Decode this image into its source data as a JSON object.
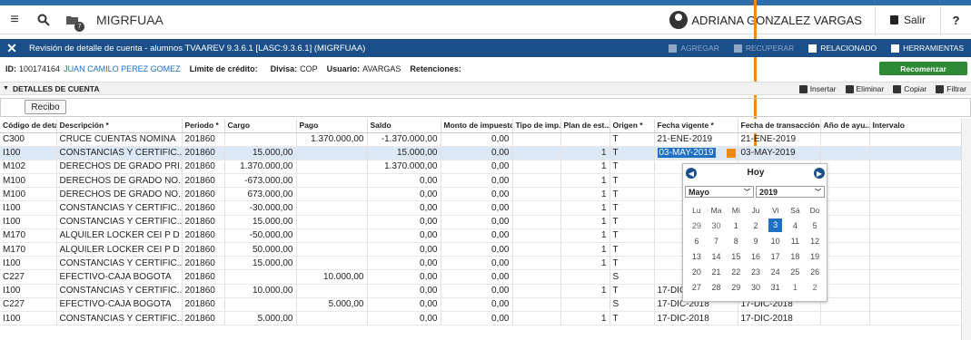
{
  "app": {
    "name": "MIGRFUAA",
    "badge": "7",
    "user": "ADRIANA GONZALEZ VARGAS",
    "logout": "Salir",
    "help": "?"
  },
  "form": {
    "title": "Revisión de detalle de cuenta - alumnos TVAAREV 9.3.6.1 [LASC:9.3.6.1] (MIGRFUAA)",
    "actions": [
      "AGREGAR",
      "RECUPERAR",
      "RELACIONADO",
      "HERRAMIENTAS"
    ]
  },
  "key": {
    "id_label": "ID:",
    "id_value": "100174164",
    "name": "JUAN CAMILO PEREZ GOMEZ",
    "credit_label": "Límite de crédito:",
    "currency_label": "Divisa:",
    "currency_value": "COP",
    "user_label": "Usuario:",
    "user_value": "AVARGAS",
    "retentions_label": "Retenciones:",
    "start_over": "Recomenzar"
  },
  "section": {
    "title": "DETALLES DE CUENTA",
    "tools": [
      "Insertar",
      "Eliminar",
      "Copiar",
      "Filtrar"
    ],
    "recibo": "Recibo"
  },
  "grid": {
    "columns": [
      "Código de deta...",
      "Descripción *",
      "Periodo *",
      "Cargo",
      "Pago",
      "Saldo",
      "Monto de impuesto",
      "Tipo de imp...",
      "Plan de est...",
      "Origen *",
      "Fecha vigente *",
      "Fecha de transacción",
      "Año de ayu...",
      "Intervalo"
    ],
    "rows": [
      [
        "C300",
        "CRUCE CUENTAS NOMINA",
        "201860",
        "",
        "1.370.000,00",
        "-1.370.000,00",
        "0,00",
        "",
        "",
        "T",
        "21-ENE-2019",
        "21-ENE-2019",
        "",
        ""
      ],
      [
        "I100",
        "CONSTANCIAS Y CERTIFIC...",
        "201860",
        "15.000,00",
        "",
        "15.000,00",
        "0,00",
        "",
        "1",
        "T",
        "03-MAY-2019",
        "03-MAY-2019",
        "",
        ""
      ],
      [
        "M102",
        "DERECHOS DE GRADO PRI...",
        "201860",
        "1.370.000,00",
        "",
        "1.370.000,00",
        "0,00",
        "",
        "1",
        "T",
        "",
        "",
        "",
        ""
      ],
      [
        "M100",
        "DERECHOS DE GRADO NO...",
        "201860",
        "-673.000,00",
        "",
        "0,00",
        "0,00",
        "",
        "1",
        "T",
        "",
        "",
        "",
        ""
      ],
      [
        "M100",
        "DERECHOS DE GRADO NO...",
        "201860",
        "673.000,00",
        "",
        "0,00",
        "0,00",
        "",
        "1",
        "T",
        "",
        "",
        "",
        ""
      ],
      [
        "I100",
        "CONSTANCIAS Y CERTIFIC...",
        "201860",
        "-30.000,00",
        "",
        "0,00",
        "0,00",
        "",
        "1",
        "T",
        "",
        "",
        "",
        ""
      ],
      [
        "I100",
        "CONSTANCIAS Y CERTIFIC...",
        "201860",
        "15.000,00",
        "",
        "0,00",
        "0,00",
        "",
        "1",
        "T",
        "",
        "",
        "",
        ""
      ],
      [
        "M170",
        "ALQUILER LOCKER CEI P D",
        "201860",
        "-50.000,00",
        "",
        "0,00",
        "0,00",
        "",
        "1",
        "T",
        "",
        "",
        "",
        ""
      ],
      [
        "M170",
        "ALQUILER LOCKER CEI P D",
        "201860",
        "50.000,00",
        "",
        "0,00",
        "0,00",
        "",
        "1",
        "T",
        "",
        "",
        "",
        ""
      ],
      [
        "I100",
        "CONSTANCIAS Y CERTIFIC...",
        "201860",
        "15.000,00",
        "",
        "0,00",
        "0,00",
        "",
        "1",
        "T",
        "",
        "",
        "",
        ""
      ],
      [
        "C227",
        "EFECTIVO-CAJA BOGOTA",
        "201860",
        "",
        "10.000,00",
        "0,00",
        "0,00",
        "",
        "",
        "S",
        "",
        "",
        "",
        ""
      ],
      [
        "I100",
        "CONSTANCIAS Y CERTIFIC...",
        "201860",
        "10.000,00",
        "",
        "0,00",
        "0,00",
        "",
        "1",
        "T",
        "17-DIC-2018",
        "17-DIC-2018",
        "",
        ""
      ],
      [
        "C227",
        "EFECTIVO-CAJA BOGOTA",
        "201860",
        "",
        "5.000,00",
        "0,00",
        "0,00",
        "",
        "",
        "S",
        "17-DIC-2018",
        "17-DIC-2018",
        "",
        ""
      ],
      [
        "I100",
        "CONSTANCIAS Y CERTIFIC...",
        "201860",
        "5.000,00",
        "",
        "0,00",
        "0,00",
        "",
        "1",
        "T",
        "17-DIC-2018",
        "17-DIC-2018",
        "",
        ""
      ]
    ]
  },
  "calendar": {
    "today_label": "Hoy",
    "month": "Mayo",
    "year": "2019",
    "weekdays": [
      "Lu",
      "Ma",
      "Mi",
      "Ju",
      "Vi",
      "Sá",
      "Do"
    ],
    "weeks": [
      [
        "29",
        "30",
        "1",
        "2",
        "3",
        "4",
        "5"
      ],
      [
        "6",
        "7",
        "8",
        "9",
        "10",
        "11",
        "12"
      ],
      [
        "13",
        "14",
        "15",
        "16",
        "17",
        "18",
        "19"
      ],
      [
        "20",
        "21",
        "22",
        "23",
        "24",
        "25",
        "26"
      ],
      [
        "27",
        "28",
        "29",
        "30",
        "31",
        "1",
        "2"
      ]
    ],
    "selected_day": "3"
  },
  "colors": {
    "header_blue": "#1b4f8a",
    "selection_blue": "#1f6fc4",
    "accent_orange": "#f08a10",
    "start_over_green": "#2d8a34"
  }
}
